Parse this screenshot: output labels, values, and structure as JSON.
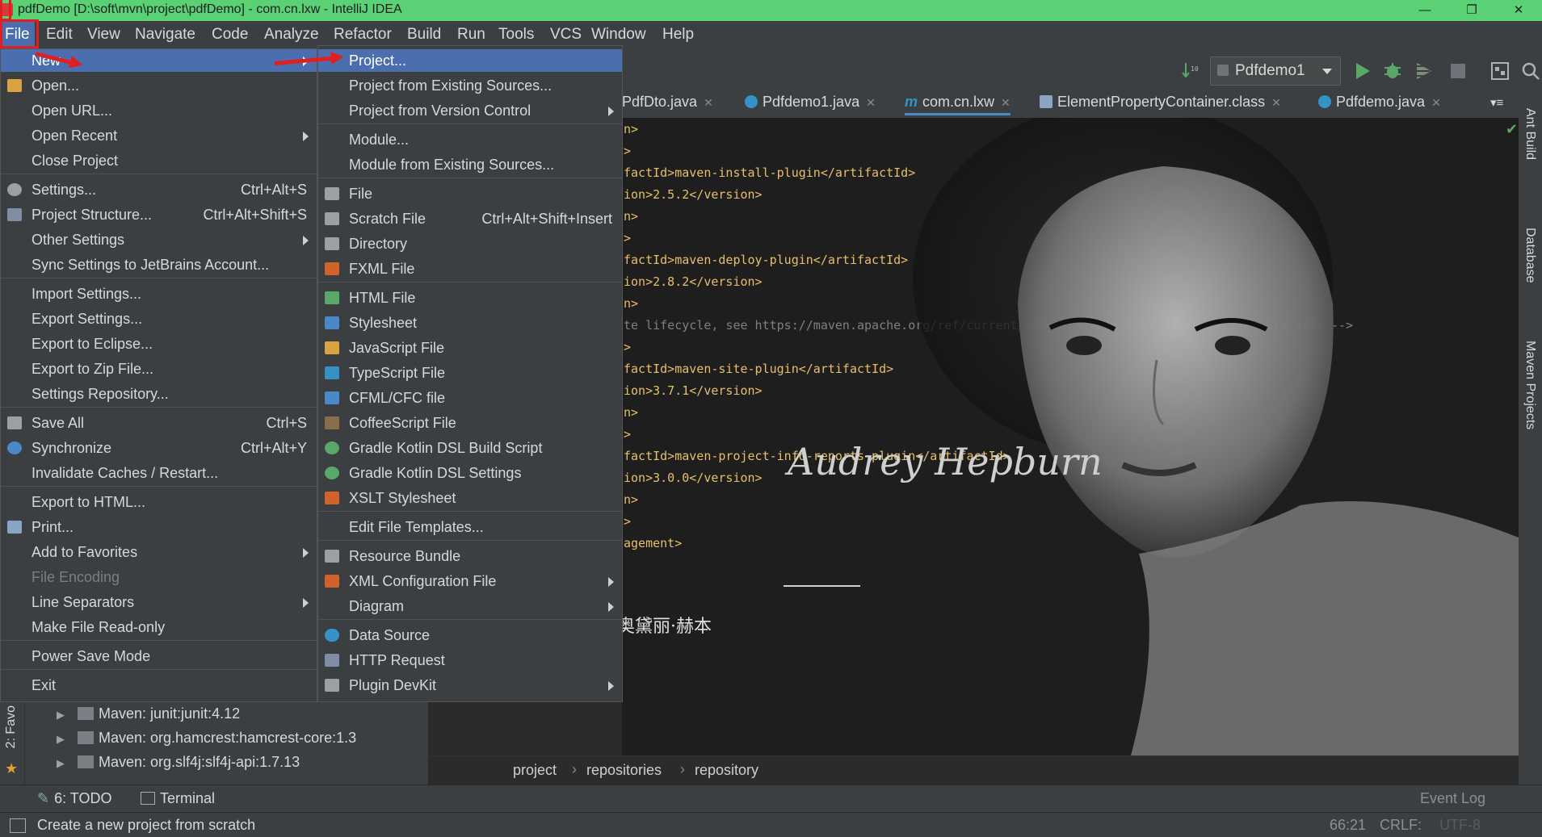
{
  "window": {
    "title": "pdfDemo [D:\\soft\\mvn\\project\\pdfDemo] - com.cn.lxw - IntelliJ IDEA",
    "min": "—",
    "max": "❐",
    "close": "✕"
  },
  "menubar": [
    "File",
    "Edit",
    "View",
    "Navigate",
    "Code",
    "Analyze",
    "Refactor",
    "Build",
    "Run",
    "Tools",
    "VCS",
    "Window",
    "Help"
  ],
  "toolbar": {
    "run_config": "Pdfdemo1"
  },
  "tabs": [
    {
      "label": "PdfDto.java"
    },
    {
      "label": "Pdfdemo1.java"
    },
    {
      "label": "com.cn.lxw"
    },
    {
      "label": "ElementPropertyContainer.class"
    },
    {
      "label": "Pdfdemo.java"
    }
  ],
  "code": [
    "n>",
    ">",
    "factId>maven-install-plugin</artifactId>",
    "ion>2.5.2</version>",
    "n>",
    ">",
    "factId>maven-deploy-plugin</artifactId>",
    "ion>2.8.2</version>",
    "n>",
    "te lifecycle, see https://maven.apache.org/ref/current/maven-core/lifecycles.html#site_Lifecycle -->",
    ">",
    "factId>maven-site-plugin</artifactId>",
    "ion>3.7.1</version>",
    "n>",
    ">",
    "factId>maven-project-info-reports-plugin</artifactId>",
    "ion>3.0.0</version>",
    "n>",
    ">",
    "agement>"
  ],
  "wallpaper": {
    "signature": "Audrey Hepburn",
    "stamp": "奥黛丽·赫本"
  },
  "file_menu": {
    "items": [
      {
        "label": "New",
        "arrow": true,
        "selected": true
      },
      {
        "label": "Open..."
      },
      {
        "label": "Open URL..."
      },
      {
        "label": "Open Recent",
        "arrow": true
      },
      {
        "label": "Close Project"
      },
      {
        "label": "Settings...",
        "shortcut": "Ctrl+Alt+S"
      },
      {
        "label": "Project Structure...",
        "shortcut": "Ctrl+Alt+Shift+S"
      },
      {
        "label": "Other Settings",
        "arrow": true
      },
      {
        "label": "Sync Settings to JetBrains Account..."
      },
      {
        "label": "Import Settings..."
      },
      {
        "label": "Export Settings..."
      },
      {
        "label": "Export to Eclipse..."
      },
      {
        "label": "Export to Zip File..."
      },
      {
        "label": "Settings Repository..."
      },
      {
        "label": "Save All",
        "shortcut": "Ctrl+S"
      },
      {
        "label": "Synchronize",
        "shortcut": "Ctrl+Alt+Y"
      },
      {
        "label": "Invalidate Caches / Restart..."
      },
      {
        "label": "Export to HTML..."
      },
      {
        "label": "Print..."
      },
      {
        "label": "Add to Favorites",
        "arrow": true
      },
      {
        "label": "File Encoding",
        "disabled": true
      },
      {
        "label": "Line Separators",
        "arrow": true
      },
      {
        "label": "Make File Read-only"
      },
      {
        "label": "Power Save Mode"
      },
      {
        "label": "Exit"
      }
    ]
  },
  "new_menu": {
    "items": [
      {
        "label": "Project...",
        "selected": true
      },
      {
        "label": "Project from Existing Sources..."
      },
      {
        "label": "Project from Version Control",
        "arrow": true
      },
      {
        "label": "Module..."
      },
      {
        "label": "Module from Existing Sources..."
      },
      {
        "label": "File"
      },
      {
        "label": "Scratch File",
        "shortcut": "Ctrl+Alt+Shift+Insert"
      },
      {
        "label": "Directory"
      },
      {
        "label": "FXML File"
      },
      {
        "label": "HTML File"
      },
      {
        "label": "Stylesheet"
      },
      {
        "label": "JavaScript File"
      },
      {
        "label": "TypeScript File"
      },
      {
        "label": "CFML/CFC file"
      },
      {
        "label": "CoffeeScript File"
      },
      {
        "label": "Gradle Kotlin DSL Build Script"
      },
      {
        "label": "Gradle Kotlin DSL Settings"
      },
      {
        "label": "XSLT Stylesheet"
      },
      {
        "label": "Edit File Templates..."
      },
      {
        "label": "Resource Bundle"
      },
      {
        "label": "XML Configuration File",
        "arrow": true
      },
      {
        "label": "Diagram",
        "arrow": true
      },
      {
        "label": "Data Source"
      },
      {
        "label": "HTTP Request"
      },
      {
        "label": "Plugin DevKit",
        "arrow": true
      }
    ]
  },
  "tree": [
    "Maven: junit:junit:4.12",
    "Maven: org.hamcrest:hamcrest-core:1.3",
    "Maven: org.slf4j:slf4j-api:1.7.13"
  ],
  "left_strip": "2: Favo",
  "right_strip": [
    "Ant Build",
    "Database",
    "Maven Projects"
  ],
  "breadcrumb": [
    "project",
    "repositories",
    "repository"
  ],
  "bottom_tools": [
    "6: TODO",
    "Terminal"
  ],
  "event_log": "Event Log",
  "status": {
    "message": "Create a new project from scratch",
    "position": "66:21",
    "line_sep": "CRLF:",
    "encoding": "UTF-8"
  },
  "colors": {
    "titlebar": "#5ad175",
    "selection": "#4b6eaf",
    "annotation": "#e02020"
  }
}
